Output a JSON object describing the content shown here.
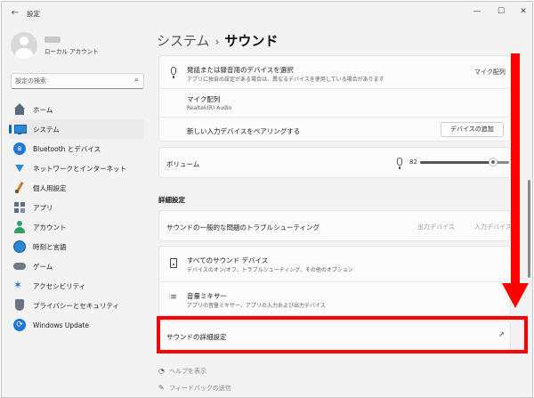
{
  "window": {
    "app_title": "設定",
    "back_glyph": "←",
    "minimize_glyph": "—",
    "maximize_glyph": "☐",
    "close_glyph": "✕"
  },
  "profile": {
    "account_type": "ローカル アカウント"
  },
  "search": {
    "placeholder": "設定の検索",
    "icon_glyph": "⌕"
  },
  "nav": {
    "items": [
      {
        "label": "ホーム",
        "icon": "home-icon",
        "active": false
      },
      {
        "label": "システム",
        "icon": "system-icon",
        "active": true
      },
      {
        "label": "Bluetooth とデバイス",
        "icon": "bluetooth-icon",
        "active": false
      },
      {
        "label": "ネットワークとインターネット",
        "icon": "network-icon",
        "active": false
      },
      {
        "label": "個人用設定",
        "icon": "brush-icon",
        "active": false
      },
      {
        "label": "アプリ",
        "icon": "apps-icon",
        "active": false
      },
      {
        "label": "アカウント",
        "icon": "account-icon",
        "active": false
      },
      {
        "label": "時刻と言語",
        "icon": "globe-clock-icon",
        "active": false
      },
      {
        "label": "ゲーム",
        "icon": "gamepad-icon",
        "active": false
      },
      {
        "label": "アクセシビリティ",
        "icon": "accessibility-icon",
        "active": false
      },
      {
        "label": "プライバシーとセキュリティ",
        "icon": "shield-icon",
        "active": false
      },
      {
        "label": "Windows Update",
        "icon": "update-icon",
        "active": false
      }
    ]
  },
  "breadcrumb": {
    "parent": "システム",
    "separator": "›",
    "current": "サウンド"
  },
  "input_card": {
    "select_device": {
      "title": "発話または録音用のデバイスを選択",
      "subtitle": "アプリに独自の設定がある場合は、異なるデバイスを使用している場合があります",
      "value": "マイク配列"
    },
    "mic_array": {
      "title": "マイク配列",
      "subtitle": "Realtek(R) Audio"
    },
    "pair_device": {
      "title": "新しい入力デバイスをペアリングする",
      "button": "デバイスの追加"
    }
  },
  "volume": {
    "label": "ボリューム",
    "value": "82",
    "level_percent": 82
  },
  "advanced": {
    "section_title": "詳細設定",
    "troubleshoot": {
      "title": "サウンドの一般的な問題のトラブルシューティング",
      "output": "出力デバイス",
      "input": "入力デバイス"
    },
    "all_devices": {
      "title": "すべてのサウンド デバイス",
      "subtitle": "デバイスのオン/オフ、トラブルシューティング、その他のオプション"
    },
    "volume_mixer": {
      "title": "音量ミキサー",
      "subtitle": "アプリの音量ミキサー、アプリの入力および出力デバイス"
    },
    "more_settings": {
      "title": "サウンドの詳細設定",
      "ext_glyph": "↗"
    }
  },
  "footer": {
    "help": "ヘルプを表示",
    "feedback": "フィードバックの送信"
  },
  "colors": {
    "accent": "#0067c0",
    "annotation_red": "#ff0000"
  }
}
